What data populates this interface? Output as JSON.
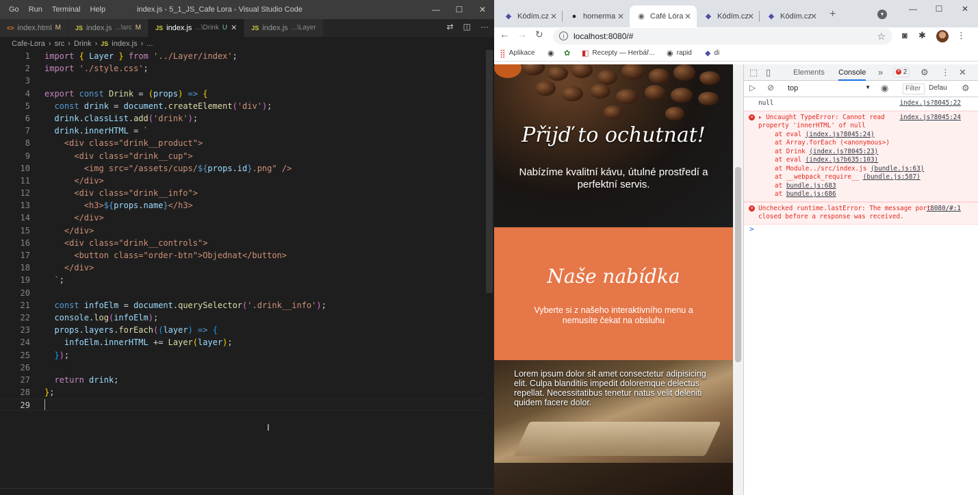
{
  "vscode": {
    "menu": [
      "Go",
      "Run",
      "Terminal",
      "Help"
    ],
    "title": "index.js - 5_1_JS_Cafe Lora - Visual Studio Code",
    "tabs": [
      {
        "icon": "<>",
        "name": "index.html",
        "path": "",
        "badge": "M",
        "active": false
      },
      {
        "icon": "JS",
        "name": "index.js",
        "path": "...\\src",
        "badge": "M",
        "active": false
      },
      {
        "icon": "JS",
        "name": "index.js",
        "path": "...\\Drink",
        "badge": "U",
        "active": true
      },
      {
        "icon": "JS",
        "name": "index.js",
        "path": "...\\Layer",
        "badge": "",
        "active": false
      }
    ],
    "breadcrumb": [
      "Cafe-Lora",
      "src",
      "Drink",
      "index.js",
      "..."
    ],
    "line_numbers": [
      "1",
      "2",
      "3",
      "4",
      "5",
      "6",
      "7",
      "8",
      "9",
      "10",
      "11",
      "12",
      "13",
      "14",
      "15",
      "16",
      "17",
      "18",
      "19",
      "20",
      "21",
      "22",
      "23",
      "24",
      "25",
      "26",
      "27",
      "28",
      "29"
    ]
  },
  "chrome": {
    "tabs": [
      {
        "label": "Kódím.cz",
        "icon": "kodim-icon"
      },
      {
        "label": "hornerma",
        "icon": "github-icon"
      },
      {
        "label": "Café Lóra",
        "icon": "globe-icon"
      },
      {
        "label": "Kódím.cz",
        "icon": "kodim-icon"
      },
      {
        "label": "Kódím.cz",
        "icon": "kodim-icon"
      }
    ],
    "new_tab": "+",
    "url": "localhost:8080/#",
    "bookmarks": [
      "Aplikace",
      "",
      "",
      "Recepty — Herbář...",
      "rapid",
      "di"
    ]
  },
  "page": {
    "hero_title": "Přijď to ochutnat!",
    "hero_text": "Nabízíme kvalitní kávu, útulné prostředí a perfektní servis.",
    "menu_title": "Naše nabídka",
    "menu_text": "Vyberte si z našeho interaktivního menu a nemusíte čekat na obsluhu",
    "interior_text": "Lorem ipsum dolor sit amet consectetur adipisicing elit. Culpa blanditiis impedit doloremque delectus repellat. Necessitatibus tenetur natus velit deleniti quidem facere dolor."
  },
  "devtools": {
    "tabs": [
      "Elements",
      "Console"
    ],
    "error_count": "2",
    "context": "top",
    "filter_placeholder": "Filter",
    "levels": "Defau",
    "messages": {
      "log_text": "null",
      "log_src": "index.js?8045:22",
      "error1_text": "Uncaught TypeError: Cannot read property 'innerHTML' of null",
      "error1_src": "index.js?8045:24",
      "trace": [
        {
          "at": "at eval",
          "link": "(index.js?8045:24)"
        },
        {
          "at": "at Array.forEach",
          "link": "(<anonymous>)"
        },
        {
          "at": "at Drink",
          "link": "(index.js?8045:23)"
        },
        {
          "at": "at eval",
          "link": "(index.js?b635:103)"
        },
        {
          "at": "at Module../src/index.js",
          "link": "(bundle.js:63)"
        },
        {
          "at": "at __webpack_require__",
          "link": "(bundle.js:587)"
        },
        {
          "at": "at",
          "link": "bundle.js:683"
        },
        {
          "at": "at",
          "link": "bundle.js:686"
        }
      ],
      "error2_text": "Unchecked runtime.lastError: The message port closed before a response was received.",
      "error2_src": ":8080/#:1"
    },
    "prompt": ">"
  }
}
